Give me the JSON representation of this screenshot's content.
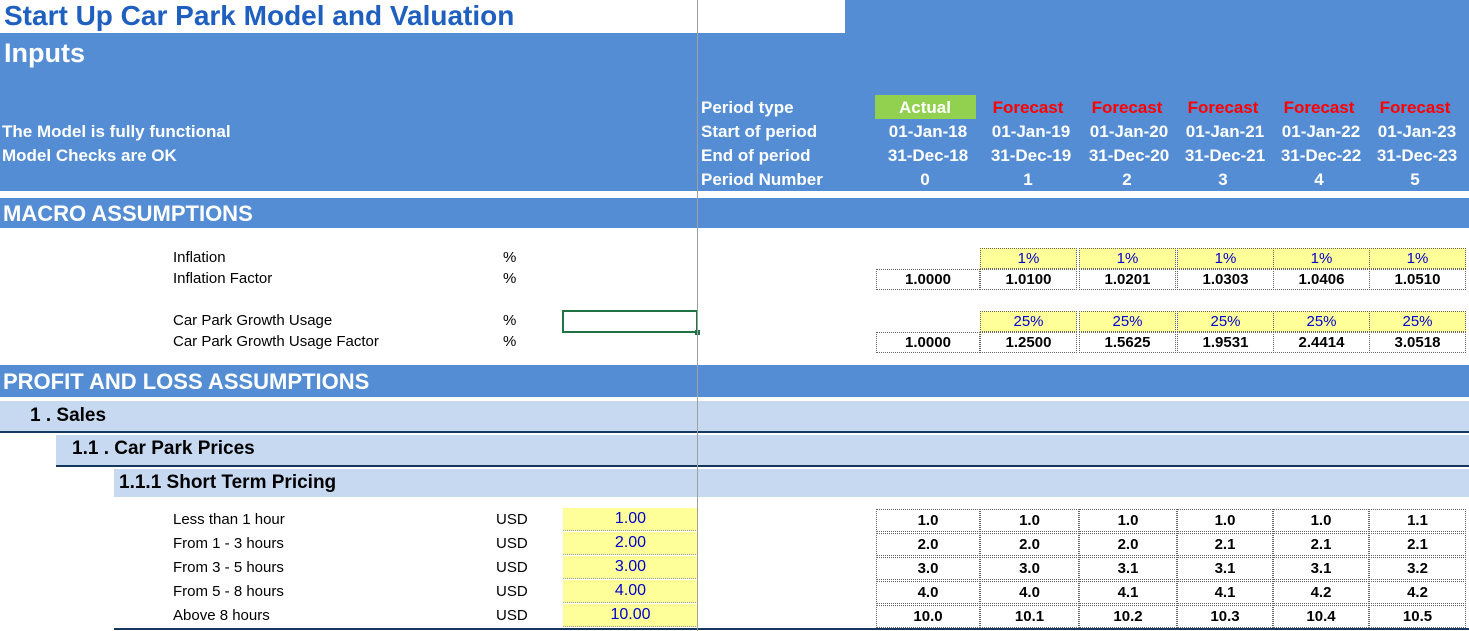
{
  "title": "Start Up Car Park Model and Valuation",
  "inputs_heading": "Inputs",
  "status": {
    "functional": "The Model is fully functional",
    "checks": "Model Checks are OK"
  },
  "header_rows": {
    "period_type": "Period type",
    "start": "Start of period",
    "end": "End of period",
    "number": "Period Number"
  },
  "periods": [
    {
      "type": "Actual",
      "start": "01-Jan-18",
      "end": "31-Dec-18",
      "number": "0"
    },
    {
      "type": "Forecast",
      "start": "01-Jan-19",
      "end": "31-Dec-19",
      "number": "1"
    },
    {
      "type": "Forecast",
      "start": "01-Jan-20",
      "end": "31-Dec-20",
      "number": "2"
    },
    {
      "type": "Forecast",
      "start": "01-Jan-21",
      "end": "31-Dec-21",
      "number": "3"
    },
    {
      "type": "Forecast",
      "start": "01-Jan-22",
      "end": "31-Dec-22",
      "number": "4"
    },
    {
      "type": "Forecast",
      "start": "01-Jan-23",
      "end": "31-Dec-23",
      "number": "5"
    }
  ],
  "colors": {
    "band": "#548dd4",
    "actual": "#92d050",
    "forecast": "#ff0000",
    "light": "#c6d9f1",
    "input": "#ffff99"
  },
  "macro": {
    "heading": "MACRO ASSUMPTIONS",
    "rows": [
      {
        "label": "Inflation",
        "unit": "%",
        "values": [
          "",
          "1%",
          "1%",
          "1%",
          "1%",
          "1%"
        ]
      },
      {
        "label": "Inflation Factor",
        "unit": "%",
        "values": [
          "1.0000",
          "1.0100",
          "1.0201",
          "1.0303",
          "1.0406",
          "1.0510"
        ]
      },
      {
        "label": "Car Park Growth Usage",
        "unit": "%",
        "values": [
          "",
          "25%",
          "25%",
          "25%",
          "25%",
          "25%"
        ]
      },
      {
        "label": "Car Park Growth Usage Factor",
        "unit": "%",
        "values": [
          "1.0000",
          "1.2500",
          "1.5625",
          "1.9531",
          "2.4414",
          "3.0518"
        ]
      }
    ]
  },
  "pl": {
    "heading": "PROFIT AND LOSS ASSUMPTIONS",
    "sales": "1 . Sales",
    "prices": "1.1 . Car Park Prices",
    "short_term": "1.1.1  Short Term Pricing",
    "rows": [
      {
        "label": "Less than 1 hour",
        "unit": "USD",
        "input": "1.00",
        "values": [
          "1.0",
          "1.0",
          "1.0",
          "1.0",
          "1.0",
          "1.1"
        ]
      },
      {
        "label": "From 1 - 3 hours",
        "unit": "USD",
        "input": "2.00",
        "values": [
          "2.0",
          "2.0",
          "2.0",
          "2.1",
          "2.1",
          "2.1"
        ]
      },
      {
        "label": "From 3 - 5 hours",
        "unit": "USD",
        "input": "3.00",
        "values": [
          "3.0",
          "3.0",
          "3.1",
          "3.1",
          "3.1",
          "3.2"
        ]
      },
      {
        "label": "From 5 - 8 hours",
        "unit": "USD",
        "input": "4.00",
        "values": [
          "4.0",
          "4.0",
          "4.1",
          "4.1",
          "4.2",
          "4.2"
        ]
      },
      {
        "label": "Above 8 hours",
        "unit": "USD",
        "input": "10.00",
        "values": [
          "10.0",
          "10.1",
          "10.2",
          "10.3",
          "10.4",
          "10.5"
        ]
      }
    ]
  }
}
